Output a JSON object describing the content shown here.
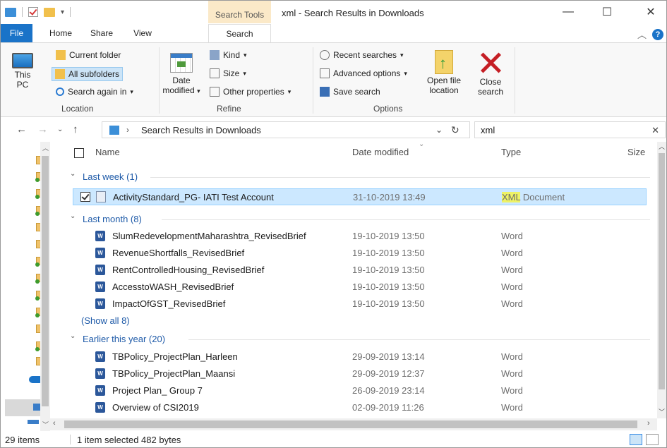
{
  "window": {
    "context_tab_header": "Search Tools",
    "title": "xml - Search Results in Downloads",
    "controls": {
      "minimize": "—",
      "maximize": "☐",
      "close": "✕"
    }
  },
  "tabs": [
    {
      "label": "File"
    },
    {
      "label": "Home"
    },
    {
      "label": "Share"
    },
    {
      "label": "View"
    },
    {
      "label": "Search"
    }
  ],
  "ribbon": {
    "location": {
      "this_pc": "This PC",
      "current_folder": "Current folder",
      "all_subfolders": "All subfolders",
      "search_again_in": "Search again in",
      "group_label": "Location"
    },
    "refine": {
      "date_modified": "Date modified",
      "kind": "Kind",
      "size": "Size",
      "other_properties": "Other properties",
      "group_label": "Refine"
    },
    "options": {
      "recent_searches": "Recent searches",
      "advanced_options": "Advanced options",
      "save_search": "Save search",
      "open_file_location": "Open file location",
      "close_search": "Close search",
      "group_label": "Options"
    }
  },
  "address": {
    "path": "Search Results in Downloads",
    "search_value": "xml"
  },
  "columns": {
    "name": "Name",
    "date_modified": "Date modified",
    "type": "Type",
    "size": "Size"
  },
  "groups": [
    {
      "label": "Last week (1)",
      "rows": [
        {
          "name": "ActivityStandard_PG- IATI Test Account",
          "date": "31-10-2019 13:49",
          "type_hl": "XML",
          "type": " Document"
        }
      ]
    },
    {
      "label": "Last month (8)",
      "rows": [
        {
          "name": "SlumRedevelopmentMaharashtra_RevisedBrief",
          "date": "19-10-2019 13:50",
          "type": "Word"
        },
        {
          "name": "RevenueShortfalls_RevisedBrief",
          "date": "19-10-2019 13:50",
          "type": "Word"
        },
        {
          "name": "RentControlledHousing_RevisedBrief",
          "date": "19-10-2019 13:50",
          "type": "Word"
        },
        {
          "name": "AccesstoWASH_RevisedBrief",
          "date": "19-10-2019 13:50",
          "type": "Word"
        },
        {
          "name": "ImpactOfGST_RevisedBrief",
          "date": "19-10-2019 13:50",
          "type": "Word"
        }
      ],
      "show_all": "(Show all 8)"
    },
    {
      "label": "Earlier this year (20)",
      "rows": [
        {
          "name": "TBPolicy_ProjectPlan_Harleen",
          "date": "29-09-2019 13:14",
          "type": "Word"
        },
        {
          "name": "TBPolicy_ProjectPlan_Maansi",
          "date": "29-09-2019 12:37",
          "type": "Word"
        },
        {
          "name": "Project Plan_ Group 7",
          "date": "26-09-2019 23:14",
          "type": "Word"
        },
        {
          "name": "Overview of CSI2019",
          "date": "02-09-2019 11:26",
          "type": "Word"
        }
      ]
    }
  ],
  "status": {
    "item_count": "29 items",
    "selection": "1 item selected  482 bytes"
  }
}
